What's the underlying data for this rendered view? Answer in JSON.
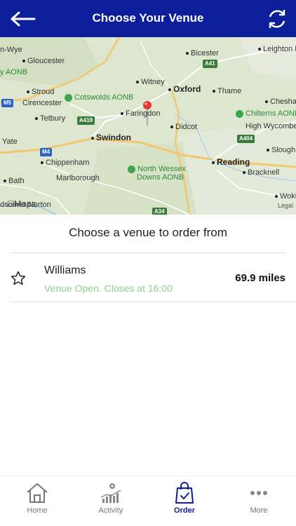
{
  "header": {
    "title": "Choose Your Venue",
    "back_icon": "arrow-left-icon",
    "refresh_icon": "refresh-icon",
    "color": "#0d1e9a"
  },
  "map": {
    "places": {
      "ross_on_wye": "n-Wye",
      "gloucester": "Gloucester",
      "bicester": "Bicester",
      "leighton": "Leighton B",
      "cotswolds_tail": "y AONB",
      "witney": "Witney",
      "stroud": "Stroud",
      "oxford": "Oxford",
      "thame": "Thame",
      "cirencester": "Cirencester",
      "cotswolds": "Cotswolds AONB",
      "chesham": "Chesha",
      "chilterns": "Chilterns AONB",
      "tetbury": "Tetbury",
      "faringdon": "Faringdon",
      "didcot": "Didcot",
      "high_wycombe": "High Wycombe",
      "swindon": "Swindon",
      "yate": "Yate",
      "slough": "Slough",
      "chippenham": "Chippenham",
      "north_wessex_1": "North Wessex",
      "north_wessex_2": "Downs AONB",
      "reading": "Reading",
      "bracknell": "Bracknell",
      "bath": "Bath",
      "marlborough": "Marlborough",
      "woking": "Woki",
      "maps_brand": "Maps",
      "bottom_left": "dsomer Norton",
      "legal": "Legal"
    },
    "roads": {
      "m5": "M5",
      "a41": "A41",
      "a419": "A419",
      "a404": "A404",
      "m4": "M4",
      "a34": "A34"
    },
    "pin_color": "#e53935"
  },
  "content": {
    "subtitle": "Choose a venue to order from",
    "venues": [
      {
        "name": "Williams",
        "status": "Venue Open. Closes at 16:00",
        "distance": "69.9 miles",
        "favorite_icon": "star-outline-icon"
      }
    ]
  },
  "tabbar": {
    "tabs": [
      {
        "label": "Home",
        "icon": "home-icon"
      },
      {
        "label": "Activity",
        "icon": "activity-icon"
      },
      {
        "label": "Order",
        "icon": "shopping-bag-icon"
      },
      {
        "label": "More",
        "icon": "more-dots-icon"
      }
    ],
    "active": "Order"
  }
}
